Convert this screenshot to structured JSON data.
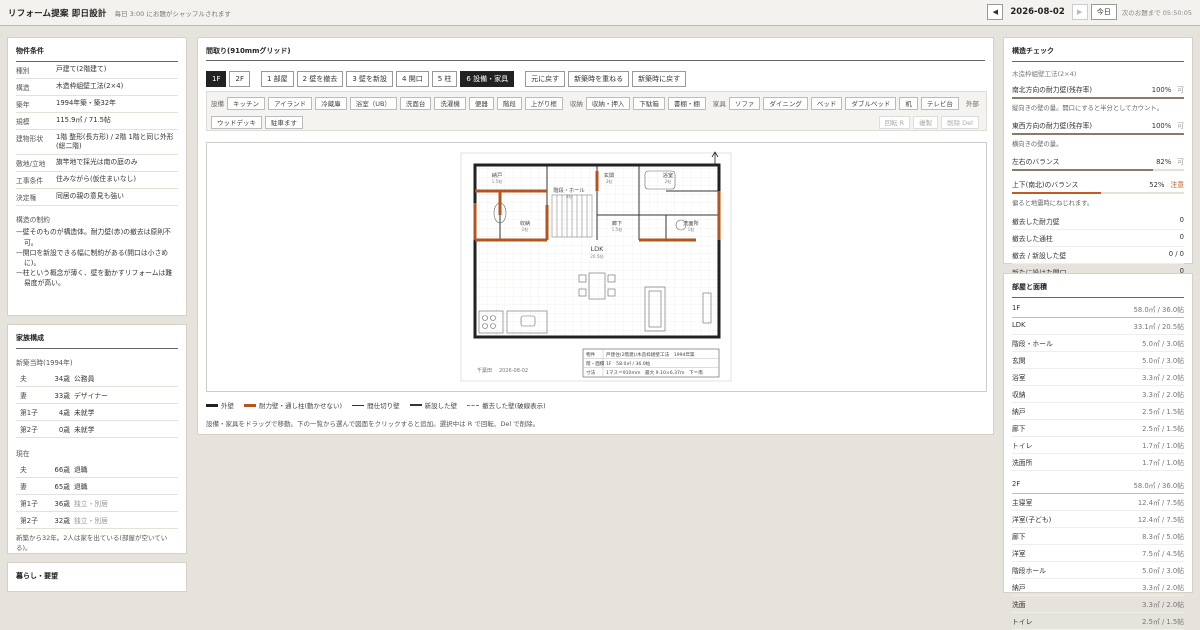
{
  "app": {
    "title": "リフォーム提案 即日設計",
    "subtitle": "毎日 3:00 にお題がシャッフルされます",
    "date": "2026-08-02",
    "today_label": "今日",
    "next_note": "次のお題まで 05:50:05",
    "prev_icon": "◀",
    "next_icon": "▶"
  },
  "property": {
    "title": "物件条件",
    "rows": [
      {
        "k": "種別",
        "v": "戸建て(2階建て)"
      },
      {
        "k": "構造",
        "v": "木造枠組壁工法(2×4)"
      },
      {
        "k": "築年",
        "v": "1994年築・築32年"
      },
      {
        "k": "規模",
        "v": "115.9㎡ / 71.5帖"
      },
      {
        "k": "建物形状",
        "v": "1階 整形(長方形) / 2階 1階と同じ外形(総二階)"
      },
      {
        "k": "敷地/立地",
        "v": "旗竿地で採光は南の庭のみ"
      },
      {
        "k": "工事条件",
        "v": "住みながら(仮住まいなし)"
      },
      {
        "k": "決定権",
        "v": "同居の親の意見も強い"
      }
    ],
    "constraints_title": "構造の制約",
    "constraints": [
      "—壁そのものが構造体。耐力壁(赤)の撤去は原則不可。",
      "—開口を新設できる幅に制約がある(開口は小さめに)。",
      "—柱という概念が薄く、壁を動かすリフォームは難易度が高い。"
    ]
  },
  "family": {
    "title": "家族構成",
    "then_title": "新築当時(1994年)",
    "then": [
      {
        "r": "夫",
        "a": "34歳",
        "j": "公務員",
        "mute": false
      },
      {
        "r": "妻",
        "a": "33歳",
        "j": "デザイナー",
        "mute": false
      },
      {
        "r": "第1子",
        "a": "4歳",
        "j": "未就学",
        "mute": false
      },
      {
        "r": "第2子",
        "a": "0歳",
        "j": "未就学",
        "mute": false
      }
    ],
    "now_title": "現在",
    "now": [
      {
        "r": "夫",
        "a": "66歳",
        "j": "退職",
        "mute": false
      },
      {
        "r": "妻",
        "a": "65歳",
        "j": "退職",
        "mute": false
      },
      {
        "r": "第1子",
        "a": "36歳",
        "j": "独立・別居",
        "mute": true
      },
      {
        "r": "第2子",
        "a": "32歳",
        "j": "独立・別居",
        "mute": true
      }
    ],
    "note": "新築から32年。2人は家を出ている(部屋が空いている)。",
    "next_title": "暮らし・要望"
  },
  "plan": {
    "title": "間取り(910mmグリッド)",
    "floors": [
      "1F",
      "2F"
    ],
    "steps": [
      "1 部屋",
      "2 壁を撤去",
      "3 壁を新設",
      "4 開口",
      "5 柱",
      "6 設備・家具"
    ],
    "actions": [
      "元に戻す",
      "新築時を重ねる",
      "新築時に戻す"
    ],
    "palette": {
      "equip_label": "設備",
      "equip": [
        "キッチン",
        "アイランド",
        "冷蔵庫",
        "浴室（UB）",
        "洗面台",
        "洗濯機",
        "便器",
        "階段",
        "上がり框"
      ],
      "storage_label": "収納",
      "storage": [
        "収納・押入",
        "下駄箱",
        "書棚・棚"
      ],
      "furn_label": "家具",
      "furn": [
        "ソファ",
        "ダイニング",
        "ベッド",
        "ダブルベッド",
        "机",
        "テレビ台"
      ],
      "ext_label": "外部",
      "ext": [
        "ウッドデッキ",
        "駐車ます"
      ],
      "tools": [
        "回転  R",
        "複製",
        "削除  Del"
      ]
    },
    "rooms": [
      {
        "name": "納戸",
        "area": "1.5帖"
      },
      {
        "name": "玄関",
        "area": "3帖"
      },
      {
        "name": "浴室",
        "area": "2帖"
      },
      {
        "name": "階段・ホール",
        "area": "3帖"
      },
      {
        "name": "収納",
        "area": "2帖"
      },
      {
        "name": "廊下",
        "area": "1.5帖"
      },
      {
        "name": "洗面所",
        "area": "1帖"
      },
      {
        "name": "LDK",
        "area": "20.5帖"
      }
    ],
    "sheet": {
      "label_l": "千葉田",
      "date": "2026-08-02",
      "row1_k": "物件",
      "row1_v": "戸建住(2階建)/木造枠組壁工法　1994年築",
      "row2_k": "階・面積",
      "row2_v": "1F　58.0㎡ / 36.0帖",
      "row3_k": "寸法",
      "row3_v": "1マス＝910mm　最大 9.10×6.37m　下＝南"
    },
    "legend": [
      "外壁",
      "耐力壁・通し柱(動かせない)",
      "間仕切り壁",
      "新設した壁",
      "撤去した壁(破線表示)"
    ],
    "help": "設備・家具をドラッグで移動。下の一覧から選んで図面をクリックすると追加。選択中は R で回転、Del で削除。"
  },
  "colors": {
    "outer": "#222222",
    "bearing": "#b5541c",
    "accent": "#8a7a66",
    "warn": "#c35a1e"
  },
  "check": {
    "title": "構造チェック",
    "system": "木造枠組壁工法(2×4)",
    "items": [
      {
        "label": "南北方向の耐力壁(残存率)",
        "value": "100%",
        "status": "可",
        "pct": 100,
        "note": "縦向きの壁の量。開口にすると半分としてカウント。",
        "warn": false
      },
      {
        "label": "東西方向の耐力壁(残存率)",
        "value": "100%",
        "status": "可",
        "pct": 100,
        "note": "横向きの壁の量。",
        "warn": false
      },
      {
        "label": "左右のバランス",
        "value": "82%",
        "status": "可",
        "pct": 82,
        "note": "",
        "warn": false
      },
      {
        "label": "上下(南北)のバランス",
        "value": "52%",
        "status": "注意",
        "pct": 52,
        "note": "偏ると地震時にねじれます。",
        "warn": true
      }
    ],
    "counts": [
      {
        "label": "撤去した耐力壁",
        "value": "0"
      },
      {
        "label": "撤去した通柱",
        "value": "0"
      },
      {
        "label": "撤去 / 新設した壁",
        "value": "0 / 0"
      },
      {
        "label": "新たに設けた開口",
        "value": "0"
      }
    ]
  },
  "areas": {
    "title": "部屋と面積",
    "f1": {
      "name": "1F",
      "total": "58.0㎡ / 36.0帖",
      "rooms": [
        {
          "n": "LDK",
          "s": "33.1㎡ / 20.5帖"
        },
        {
          "n": "階段・ホール",
          "s": "5.0㎡ / 3.0帖"
        },
        {
          "n": "玄関",
          "s": "5.0㎡ / 3.0帖"
        },
        {
          "n": "浴室",
          "s": "3.3㎡ / 2.0帖"
        },
        {
          "n": "収納",
          "s": "3.3㎡ / 2.0帖"
        },
        {
          "n": "納戸",
          "s": "2.5㎡ / 1.5帖"
        },
        {
          "n": "廊下",
          "s": "2.5㎡ / 1.5帖"
        },
        {
          "n": "トイレ",
          "s": "1.7㎡ / 1.0帖"
        },
        {
          "n": "洗面所",
          "s": "1.7㎡ / 1.0帖"
        }
      ]
    },
    "f2": {
      "name": "2F",
      "total": "58.0㎡ / 36.0帖",
      "rooms": [
        {
          "n": "主寝室",
          "s": "12.4㎡ / 7.5帖"
        },
        {
          "n": "洋室(子ども)",
          "s": "12.4㎡ / 7.5帖"
        },
        {
          "n": "廊下",
          "s": "8.3㎡ / 5.0帖"
        },
        {
          "n": "洋室",
          "s": "7.5㎡ / 4.5帖"
        },
        {
          "n": "階段ホール",
          "s": "5.0㎡ / 3.0帖"
        },
        {
          "n": "納戸",
          "s": "3.3㎡ / 2.0帖"
        },
        {
          "n": "洗面",
          "s": "3.3㎡ / 2.0帖"
        },
        {
          "n": "トイレ",
          "s": "2.5㎡ / 1.5帖"
        }
      ]
    }
  }
}
